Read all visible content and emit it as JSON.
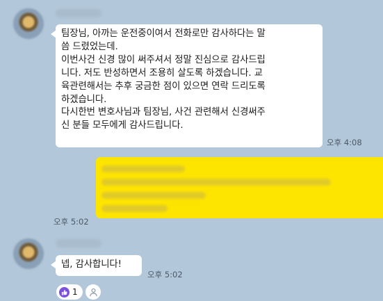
{
  "messages": [
    {
      "sender": "other",
      "lines": [
        "팀장님, 아까는 운전중이여서 전화로만 감사하다는 말",
        "씀 드렸었는데.",
        "이번사건 신경 많이 써주셔서 정말 진심으로 감사드립",
        "니다. 저도 반성하면서 조용히 살도록 하겠습니다. 교",
        "육관련해서는 추후 궁금한 점이 있으면 연락 드리도록",
        " 하겠습니다.",
        "다시한번 변호사님과 팀장님, 사건 관련해서 신경써주",
        "신 분들 모두에게 감사드립니다."
      ],
      "time": "오후 4:08"
    },
    {
      "sender": "me",
      "time": "오후 5:02"
    },
    {
      "sender": "other",
      "text": "넵, 감사합니다!",
      "time": "오후 5:02",
      "reaction": {
        "icon": "thumbs-up-icon",
        "count": "1"
      }
    }
  ],
  "colors": {
    "background": "#b2c7d9",
    "my_bubble": "#fee500",
    "other_bubble": "#ffffff",
    "reaction_accent": "#7b4fe0"
  }
}
